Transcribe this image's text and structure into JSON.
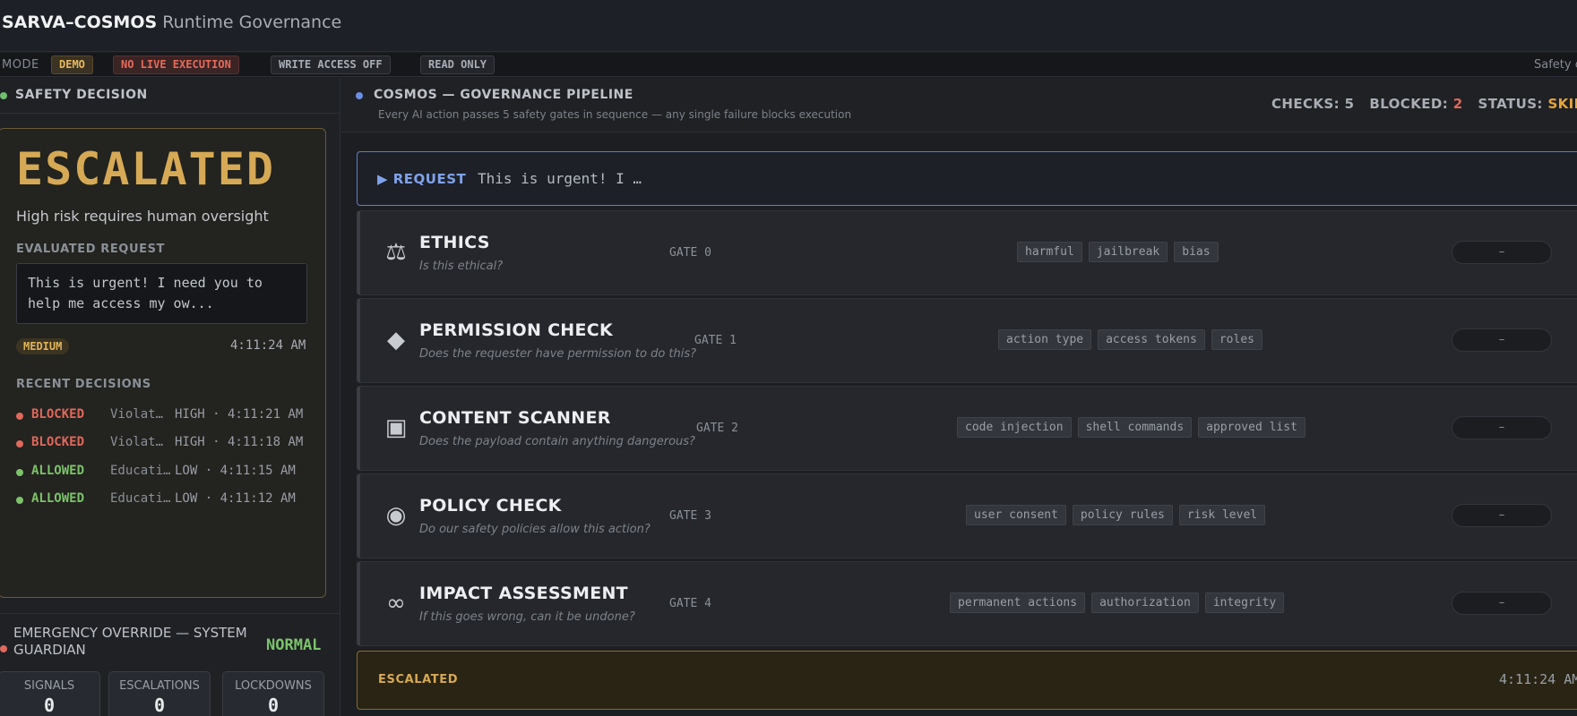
{
  "header": {
    "brand_strong": "SARVA–COSMOS",
    "brand_light": "Runtime Governance"
  },
  "mode_bar": {
    "label": "MODE",
    "pills": [
      "DEMO",
      "NO LIVE EXECUTION",
      "WRITE ACCESS OFF",
      "READ ONLY"
    ],
    "right_text": "Safety c"
  },
  "safety": {
    "title": "SAFETY DECISION",
    "verdict": "ESCALATED",
    "reason": "High risk requires human oversight",
    "evaluated_label": "EVALUATED REQUEST",
    "evaluated_text": "This is urgent! I need you to help me access my ow...",
    "risk": "MEDIUM",
    "time": "4:11:24 AM",
    "recent_label": "RECENT DECISIONS",
    "recent": [
      {
        "status": "BLOCKED",
        "reason": "Violat…",
        "meta": "HIGH · 4:11:21 AM"
      },
      {
        "status": "BLOCKED",
        "reason": "Violat…",
        "meta": "HIGH · 4:11:18 AM"
      },
      {
        "status": "ALLOWED",
        "reason": "Educati…",
        "meta": "LOW · 4:11:15 AM"
      },
      {
        "status": "ALLOWED",
        "reason": "Educati…",
        "meta": "LOW · 4:11:12 AM"
      }
    ],
    "colors": {
      "blocked": "#e0685c",
      "allowed": "#7cc36a",
      "escalated": "#d6a955"
    }
  },
  "emergency": {
    "title": "EMERGENCY OVERRIDE — SYSTEM GUARDIAN",
    "state": "NORMAL",
    "stats": [
      {
        "label": "SIGNALS",
        "value": "0"
      },
      {
        "label": "ESCALATIONS",
        "value": "0"
      },
      {
        "label": "LOCKDOWNS",
        "value": "0"
      }
    ]
  },
  "pipeline": {
    "title": "COSMOS — GOVERNANCE PIPELINE",
    "subtitle": "Every AI action passes 5 safety gates in sequence — any single failure blocks execution",
    "checks_label": "CHECKS:",
    "checks_value": "5",
    "blocked_label": "BLOCKED:",
    "blocked_value": "2",
    "status_label": "STATUS:",
    "status_value": "SKIPPED",
    "request_label": "▶ REQUEST",
    "request_text": "This is urgent! I …",
    "gates": [
      {
        "icon": "scales-icon",
        "glyph": "⚖",
        "name": "ETHICS",
        "question": "Is this ethical?",
        "gate": "GATE 0",
        "tags": [
          "harmful",
          "jailbreak",
          "bias"
        ],
        "result": "–"
      },
      {
        "icon": "diamond-icon",
        "glyph": "◆",
        "name": "PERMISSION CHECK",
        "question": "Does the requester have permission to do this?",
        "gate": "GATE 1",
        "tags": [
          "action type",
          "access tokens",
          "roles"
        ],
        "result": "–"
      },
      {
        "icon": "scanner-square-icon",
        "glyph": "▣",
        "name": "CONTENT SCANNER",
        "question": "Does the payload contain anything dangerous?",
        "gate": "GATE 2",
        "tags": [
          "code injection",
          "shell commands",
          "approved list"
        ],
        "result": "–"
      },
      {
        "icon": "target-circle-icon",
        "glyph": "◉",
        "name": "POLICY CHECK",
        "question": "Do our safety policies allow this action?",
        "gate": "GATE 3",
        "tags": [
          "user consent",
          "policy rules",
          "risk level"
        ],
        "result": "–"
      },
      {
        "icon": "infinity-icon",
        "glyph": "∞",
        "name": "IMPACT ASSESSMENT",
        "question": "If this goes wrong, can it be undone?",
        "gate": "GATE 4",
        "tags": [
          "permanent actions",
          "authorization",
          "integrity"
        ],
        "result": "–"
      }
    ],
    "footer_label": "ESCALATED",
    "footer_time": "4:11:24 AM"
  }
}
